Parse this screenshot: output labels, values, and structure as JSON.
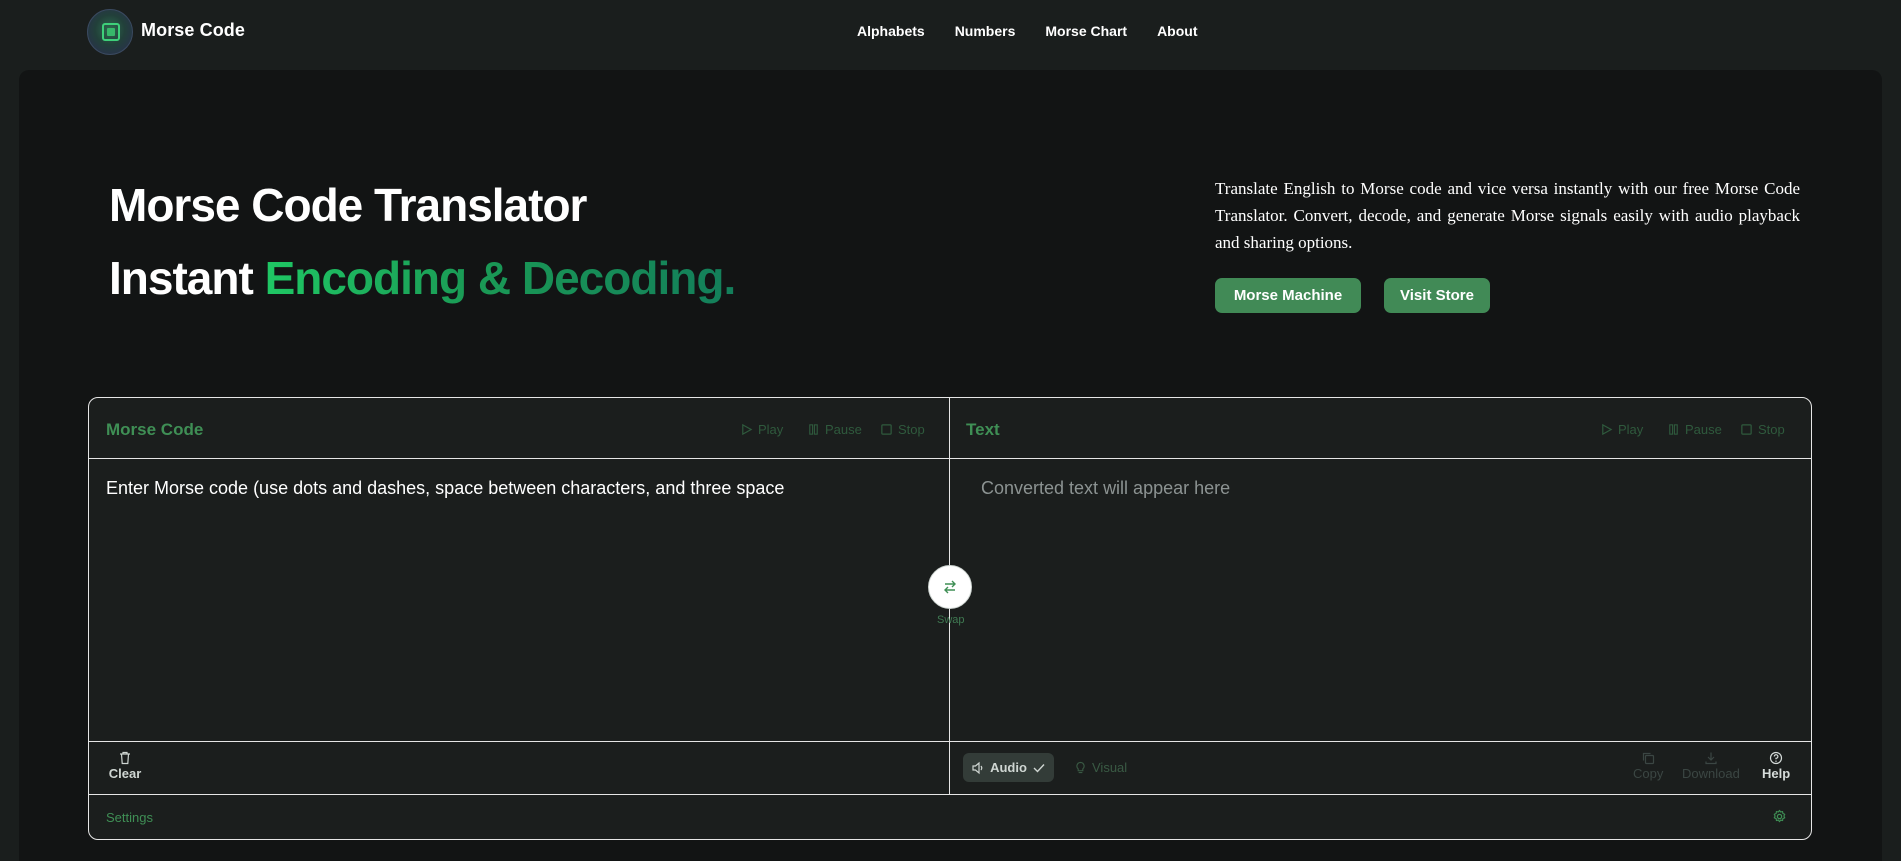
{
  "nav": {
    "brand": "Morse Code",
    "links": [
      "Alphabets",
      "Numbers",
      "Morse Chart",
      "About"
    ]
  },
  "hero": {
    "title": "Morse Code Translator",
    "subtitle_plain": "Instant ",
    "subtitle_accent": "Encoding & Decoding.",
    "description": "Translate English to Morse code and vice versa instantly with our free Morse Code Translator. Convert, decode, and generate Morse signals easily with audio playback and sharing options.",
    "buttons": {
      "machine": "Morse Machine",
      "store": "Visit Store"
    }
  },
  "translator": {
    "left": {
      "title": "Morse Code",
      "play": "Play",
      "pause": "Pause",
      "stop": "Stop",
      "placeholder": "Enter Morse code (use dots and dashes, space between characters, and three space"
    },
    "right": {
      "title": "Text",
      "play": "Play",
      "pause": "Pause",
      "stop": "Stop",
      "placeholder": "Converted text will appear here"
    },
    "swap_label": "Swap",
    "clear_label": "Clear",
    "audio_label": "Audio",
    "visual_label": "Visual",
    "copy_label": "Copy",
    "download_label": "Download",
    "help_label": "Help",
    "settings_label": "Settings"
  },
  "colors": {
    "accent": "#418a56",
    "accent_text": "#3f8f55",
    "panel_bg": "#121414",
    "page_bg": "#1a1e1d"
  }
}
